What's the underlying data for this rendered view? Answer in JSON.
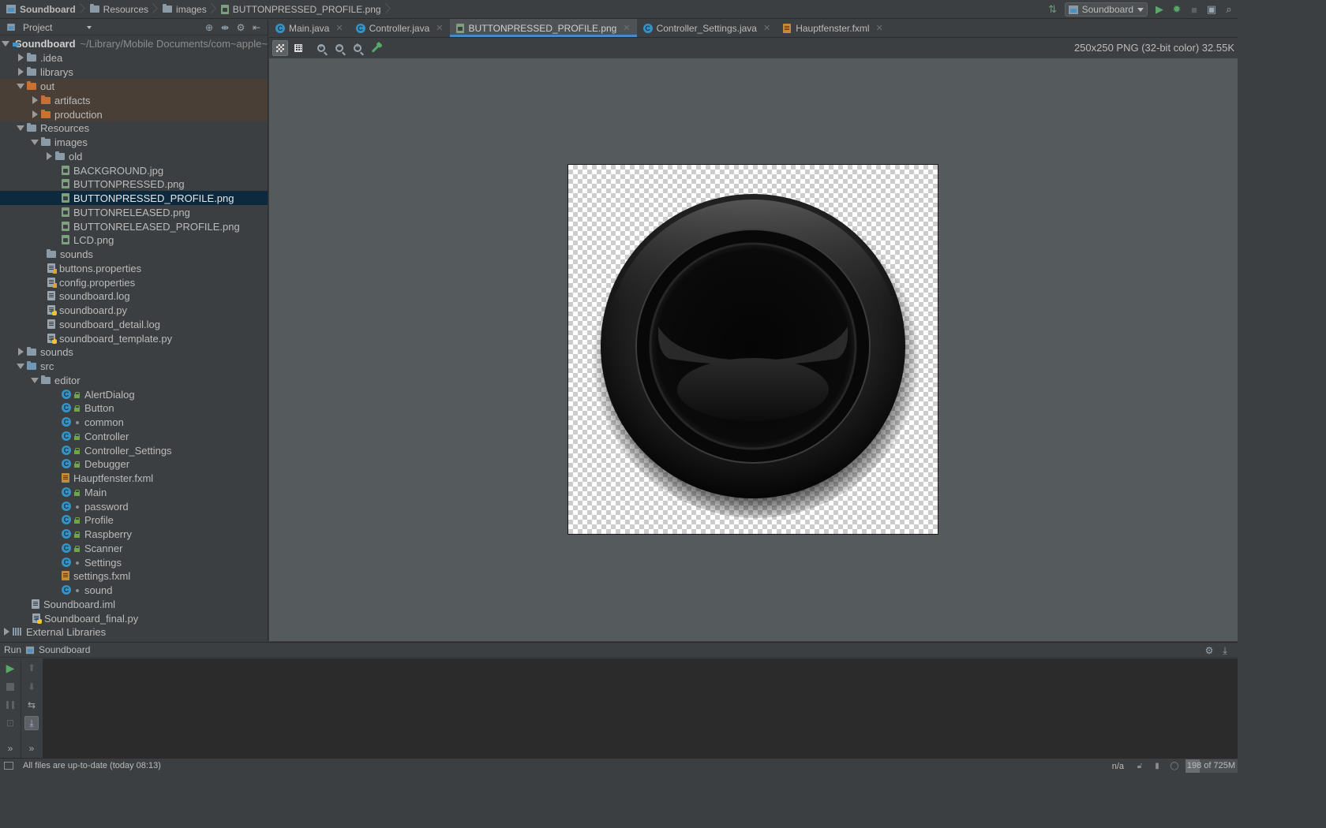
{
  "breadcrumb": [
    "Soundboard",
    "Resources",
    "images",
    "BUTTONPRESSED_PROFILE.png"
  ],
  "toolbar": {
    "run_config": "Soundboard"
  },
  "project": {
    "header_label": "Project",
    "rows": [
      {
        "label": "Soundboard",
        "hint": "~/Library/Mobile Documents/com~apple~CloudDocs",
        "kind": "root"
      },
      {
        "label": ".idea"
      },
      {
        "label": "librarys"
      },
      {
        "label": "out"
      },
      {
        "label": "artifacts"
      },
      {
        "label": "production"
      },
      {
        "label": "Resources"
      },
      {
        "label": "images"
      },
      {
        "label": "old"
      },
      {
        "label": "BACKGROUND.jpg"
      },
      {
        "label": "BUTTONPRESSED.png"
      },
      {
        "label": "BUTTONPRESSED_PROFILE.png"
      },
      {
        "label": "BUTTONRELEASED.png"
      },
      {
        "label": "BUTTONRELEASED_PROFILE.png"
      },
      {
        "label": "LCD.png"
      },
      {
        "label": "sounds"
      },
      {
        "label": "buttons.properties"
      },
      {
        "label": "config.properties"
      },
      {
        "label": "soundboard.log"
      },
      {
        "label": "soundboard.py"
      },
      {
        "label": "soundboard_detail.log"
      },
      {
        "label": "soundboard_template.py"
      },
      {
        "label": "sounds"
      },
      {
        "label": "src"
      },
      {
        "label": "editor"
      },
      {
        "label": "AlertDialog"
      },
      {
        "label": "Button"
      },
      {
        "label": "common"
      },
      {
        "label": "Controller"
      },
      {
        "label": "Controller_Settings"
      },
      {
        "label": "Debugger"
      },
      {
        "label": "Hauptfenster.fxml"
      },
      {
        "label": "Main"
      },
      {
        "label": "password"
      },
      {
        "label": "Profile"
      },
      {
        "label": "Raspberry"
      },
      {
        "label": "Scanner"
      },
      {
        "label": "Settings"
      },
      {
        "label": "settings.fxml"
      },
      {
        "label": "sound"
      },
      {
        "label": "Soundboard.iml"
      },
      {
        "label": "Soundboard_final.py"
      },
      {
        "label": "External Libraries"
      }
    ]
  },
  "tabs": [
    {
      "label": "Main.java",
      "icon": "class-icon"
    },
    {
      "label": "Controller.java",
      "icon": "class-icon"
    },
    {
      "label": "BUTTONPRESSED_PROFILE.png",
      "icon": "image-file-icon",
      "active": true
    },
    {
      "label": "Controller_Settings.java",
      "icon": "class-icon"
    },
    {
      "label": "Hauptfenster.fxml",
      "icon": "fxml-file-icon"
    }
  ],
  "image_viewer": {
    "info": "250x250 PNG (32-bit color) 32.55K"
  },
  "run_panel": {
    "label": "Run",
    "config": "Soundboard"
  },
  "status": {
    "message": "All files are up-to-date (today 08:13)",
    "position": "n/a",
    "memory": "198 of 725M",
    "memory_used_fraction": 0.27
  },
  "colors": {
    "accent": "#4a88c7",
    "selection": "#0d293e",
    "excluded_bg": "#4a3f36",
    "run_green": "#59a869",
    "background": "#3c3f41"
  }
}
